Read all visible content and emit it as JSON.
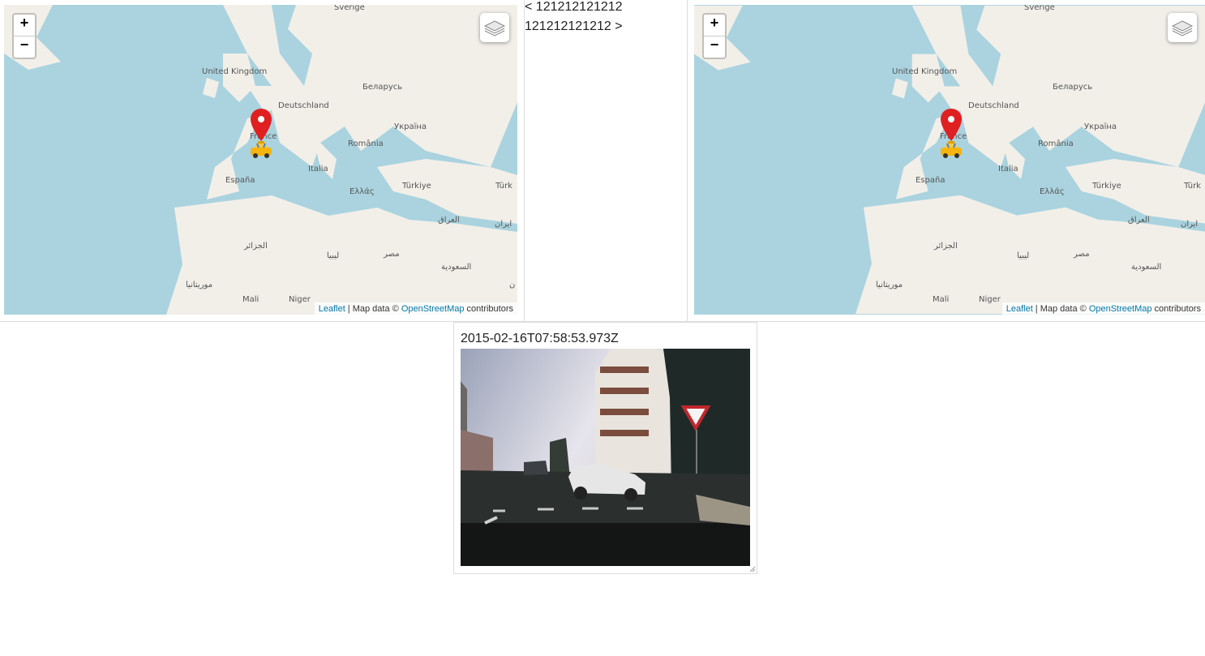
{
  "maps": {
    "left": {
      "zoom_in": "+",
      "zoom_out": "−",
      "attribution": {
        "leaflet": "Leaflet",
        "sep": " | Map data © ",
        "osm": "OpenStreetMap",
        "contrib": " contributors"
      }
    },
    "right": {
      "zoom_in": "+",
      "zoom_out": "−",
      "attribution": {
        "leaflet": "Leaflet",
        "sep": " | Map data © ",
        "osm": "OpenStreetMap",
        "contrib": " contributors"
      }
    },
    "labels": {
      "sverige": "Sverige",
      "uk": "United Kingdom",
      "belarus": "Беларусь",
      "deutschland": "Deutschland",
      "ukraine": "Україна",
      "france": "France",
      "romania": "România",
      "italia": "Italia",
      "espana": "España",
      "ellas": "Ελλάς",
      "turkiye": "Türkiye",
      "turk_cut": "Türk",
      "iraq": "العراق",
      "iran": "ایران",
      "algeria": "الجزائر",
      "libya": "ليبيا",
      "egypt": "مصر",
      "saudi": "السعودية",
      "mauritania": "موريتانيا",
      "mali": "Mali",
      "niger": "Niger",
      "cut_right": "ن"
    },
    "icons": {
      "marker": "map-marker-icon",
      "vehicle": "taxi-icon",
      "layers": "layers-icon"
    },
    "colors": {
      "water": "#aad3df",
      "land": "#f2efe9",
      "marker": "#e02020"
    }
  },
  "navigation": {
    "prev": "< 121212121212",
    "next": "121212121212 >"
  },
  "frame": {
    "timestamp": "2015-02-16T07:58:53.973Z"
  }
}
